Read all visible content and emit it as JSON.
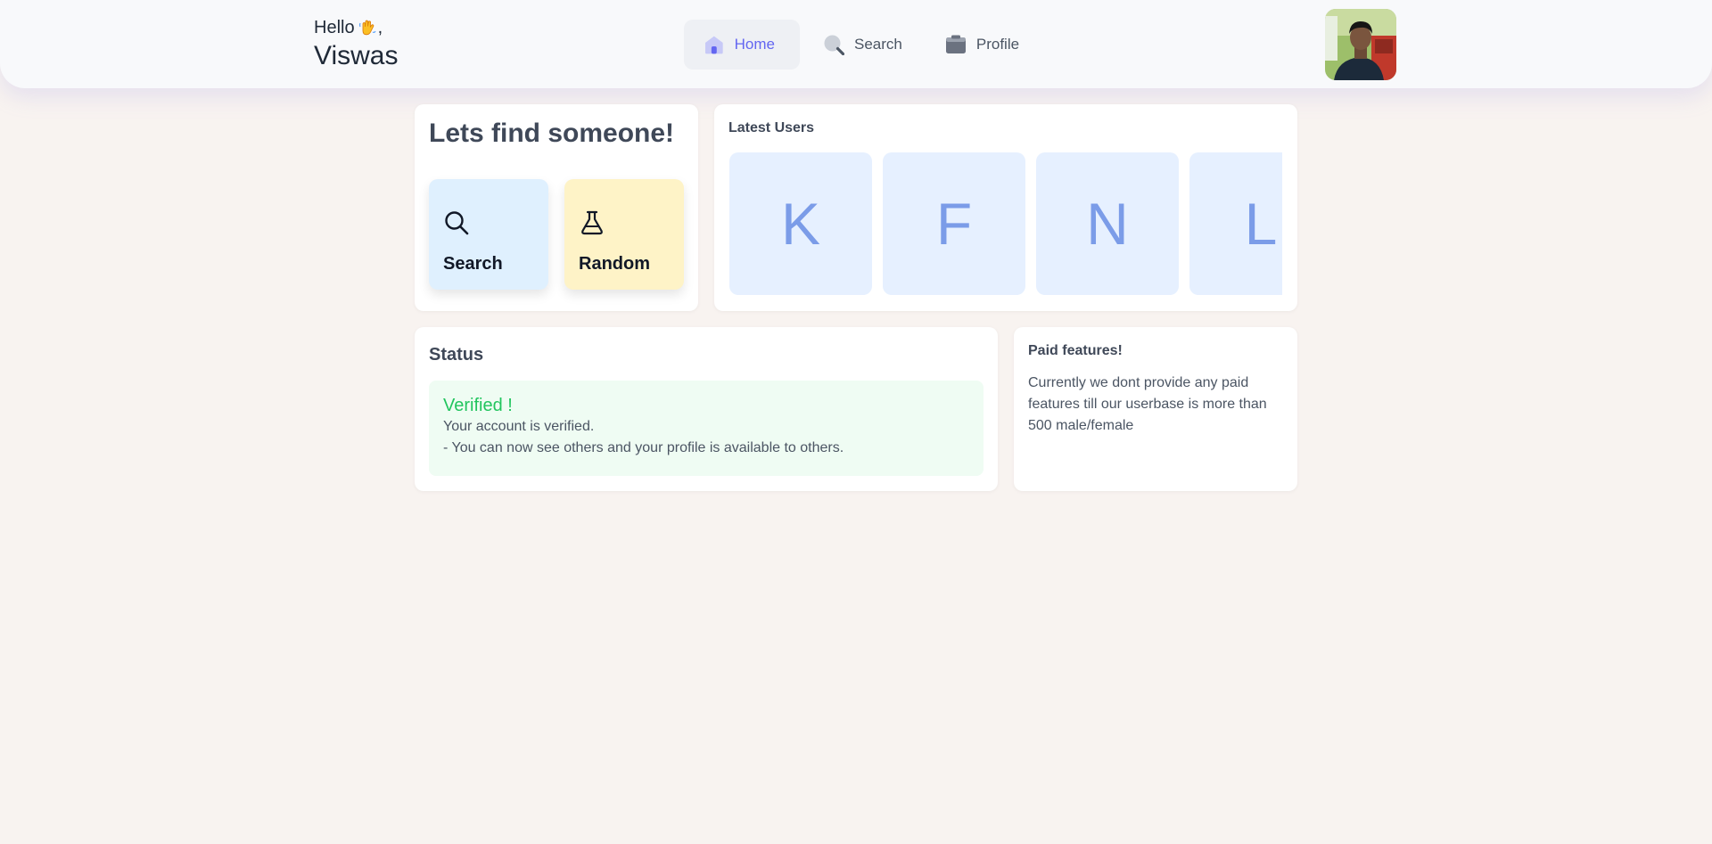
{
  "header": {
    "greeting": "Hello",
    "greeting_suffix": ",",
    "username": "Viswas"
  },
  "nav": {
    "items": [
      {
        "label": "Home",
        "icon": "home-icon",
        "active": true
      },
      {
        "label": "Search",
        "icon": "search-icon",
        "active": false
      },
      {
        "label": "Profile",
        "icon": "profile-icon",
        "active": false
      }
    ]
  },
  "find": {
    "title": "Lets find someone!",
    "search_label": "Search",
    "random_label": "Random"
  },
  "latest_users": {
    "title": "Latest Users",
    "initials": [
      "K",
      "F",
      "N",
      "L"
    ]
  },
  "status": {
    "title": "Status",
    "verified_title": "Verified !",
    "line1": "Your account is verified.",
    "line2": "- You can now see others and your profile is available to others."
  },
  "paid": {
    "title": "Paid features!",
    "text": "Currently we dont provide any paid features till our userbase is more than 500 male/female"
  },
  "colors": {
    "accent": "#6366f1",
    "page_bg": "#f8f3f0",
    "verified": "#22c55e",
    "search_tile": "#dff0fe",
    "random_tile": "#fef3c7",
    "user_tile": "#e6f0ff"
  }
}
